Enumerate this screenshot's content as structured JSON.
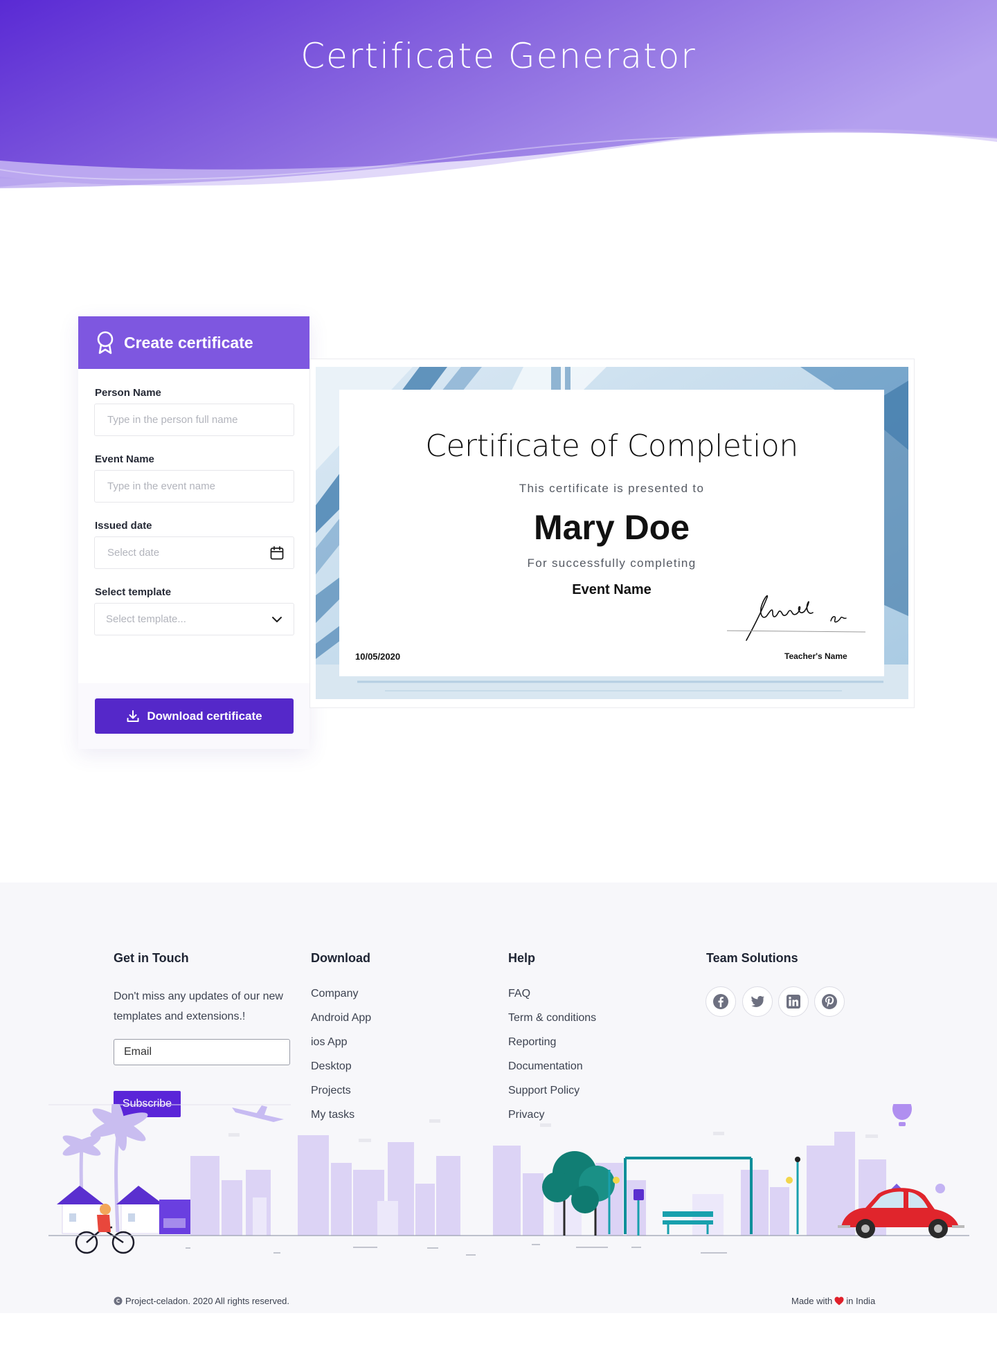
{
  "header": {
    "title": "Certificate Generator"
  },
  "form": {
    "heading": "Create certificate",
    "fields": {
      "person_name": {
        "label": "Person Name",
        "placeholder": "Type in the person full name"
      },
      "event_name": {
        "label": "Event Name",
        "placeholder": "Type in the event name"
      },
      "issued_date": {
        "label": "Issued date",
        "placeholder": "Select date"
      },
      "template": {
        "label": "Select template",
        "value": "Select template..."
      }
    },
    "download_label": "Download certificate"
  },
  "certificate": {
    "title": "Certificate of Completion",
    "presented": "This certificate is presented to",
    "name": "Mary Doe",
    "completing": "For successfully completing",
    "event": "Event Name",
    "date": "10/05/2020",
    "teacher": "Teacher's Name"
  },
  "footer": {
    "get_in_touch": {
      "title": "Get in Touch",
      "text": "Don't miss any updates of our new templates and extensions.!",
      "email_placeholder": "Email",
      "subscribe_label": "Subscribe"
    },
    "download": {
      "title": "Download",
      "links": [
        "Company",
        "Android App",
        "ios App",
        "Desktop",
        "Projects",
        "My tasks"
      ]
    },
    "help": {
      "title": "Help",
      "links": [
        "FAQ",
        "Term & conditions",
        "Reporting",
        "Documentation",
        "Support Policy",
        "Privacy"
      ]
    },
    "team": {
      "title": "Team Solutions",
      "social_icons": [
        "facebook-icon",
        "twitter-icon",
        "linkedin-icon",
        "pinterest-icon"
      ]
    },
    "copyright": "Project-celadon. 2020 All rights reserved.",
    "made_with_prefix": "Made with",
    "made_with_suffix": "in India"
  },
  "colors": {
    "primary": "#7e57e0",
    "button": "#5528c9",
    "subscribe": "#5a25d8",
    "heart": "#e0202a"
  }
}
